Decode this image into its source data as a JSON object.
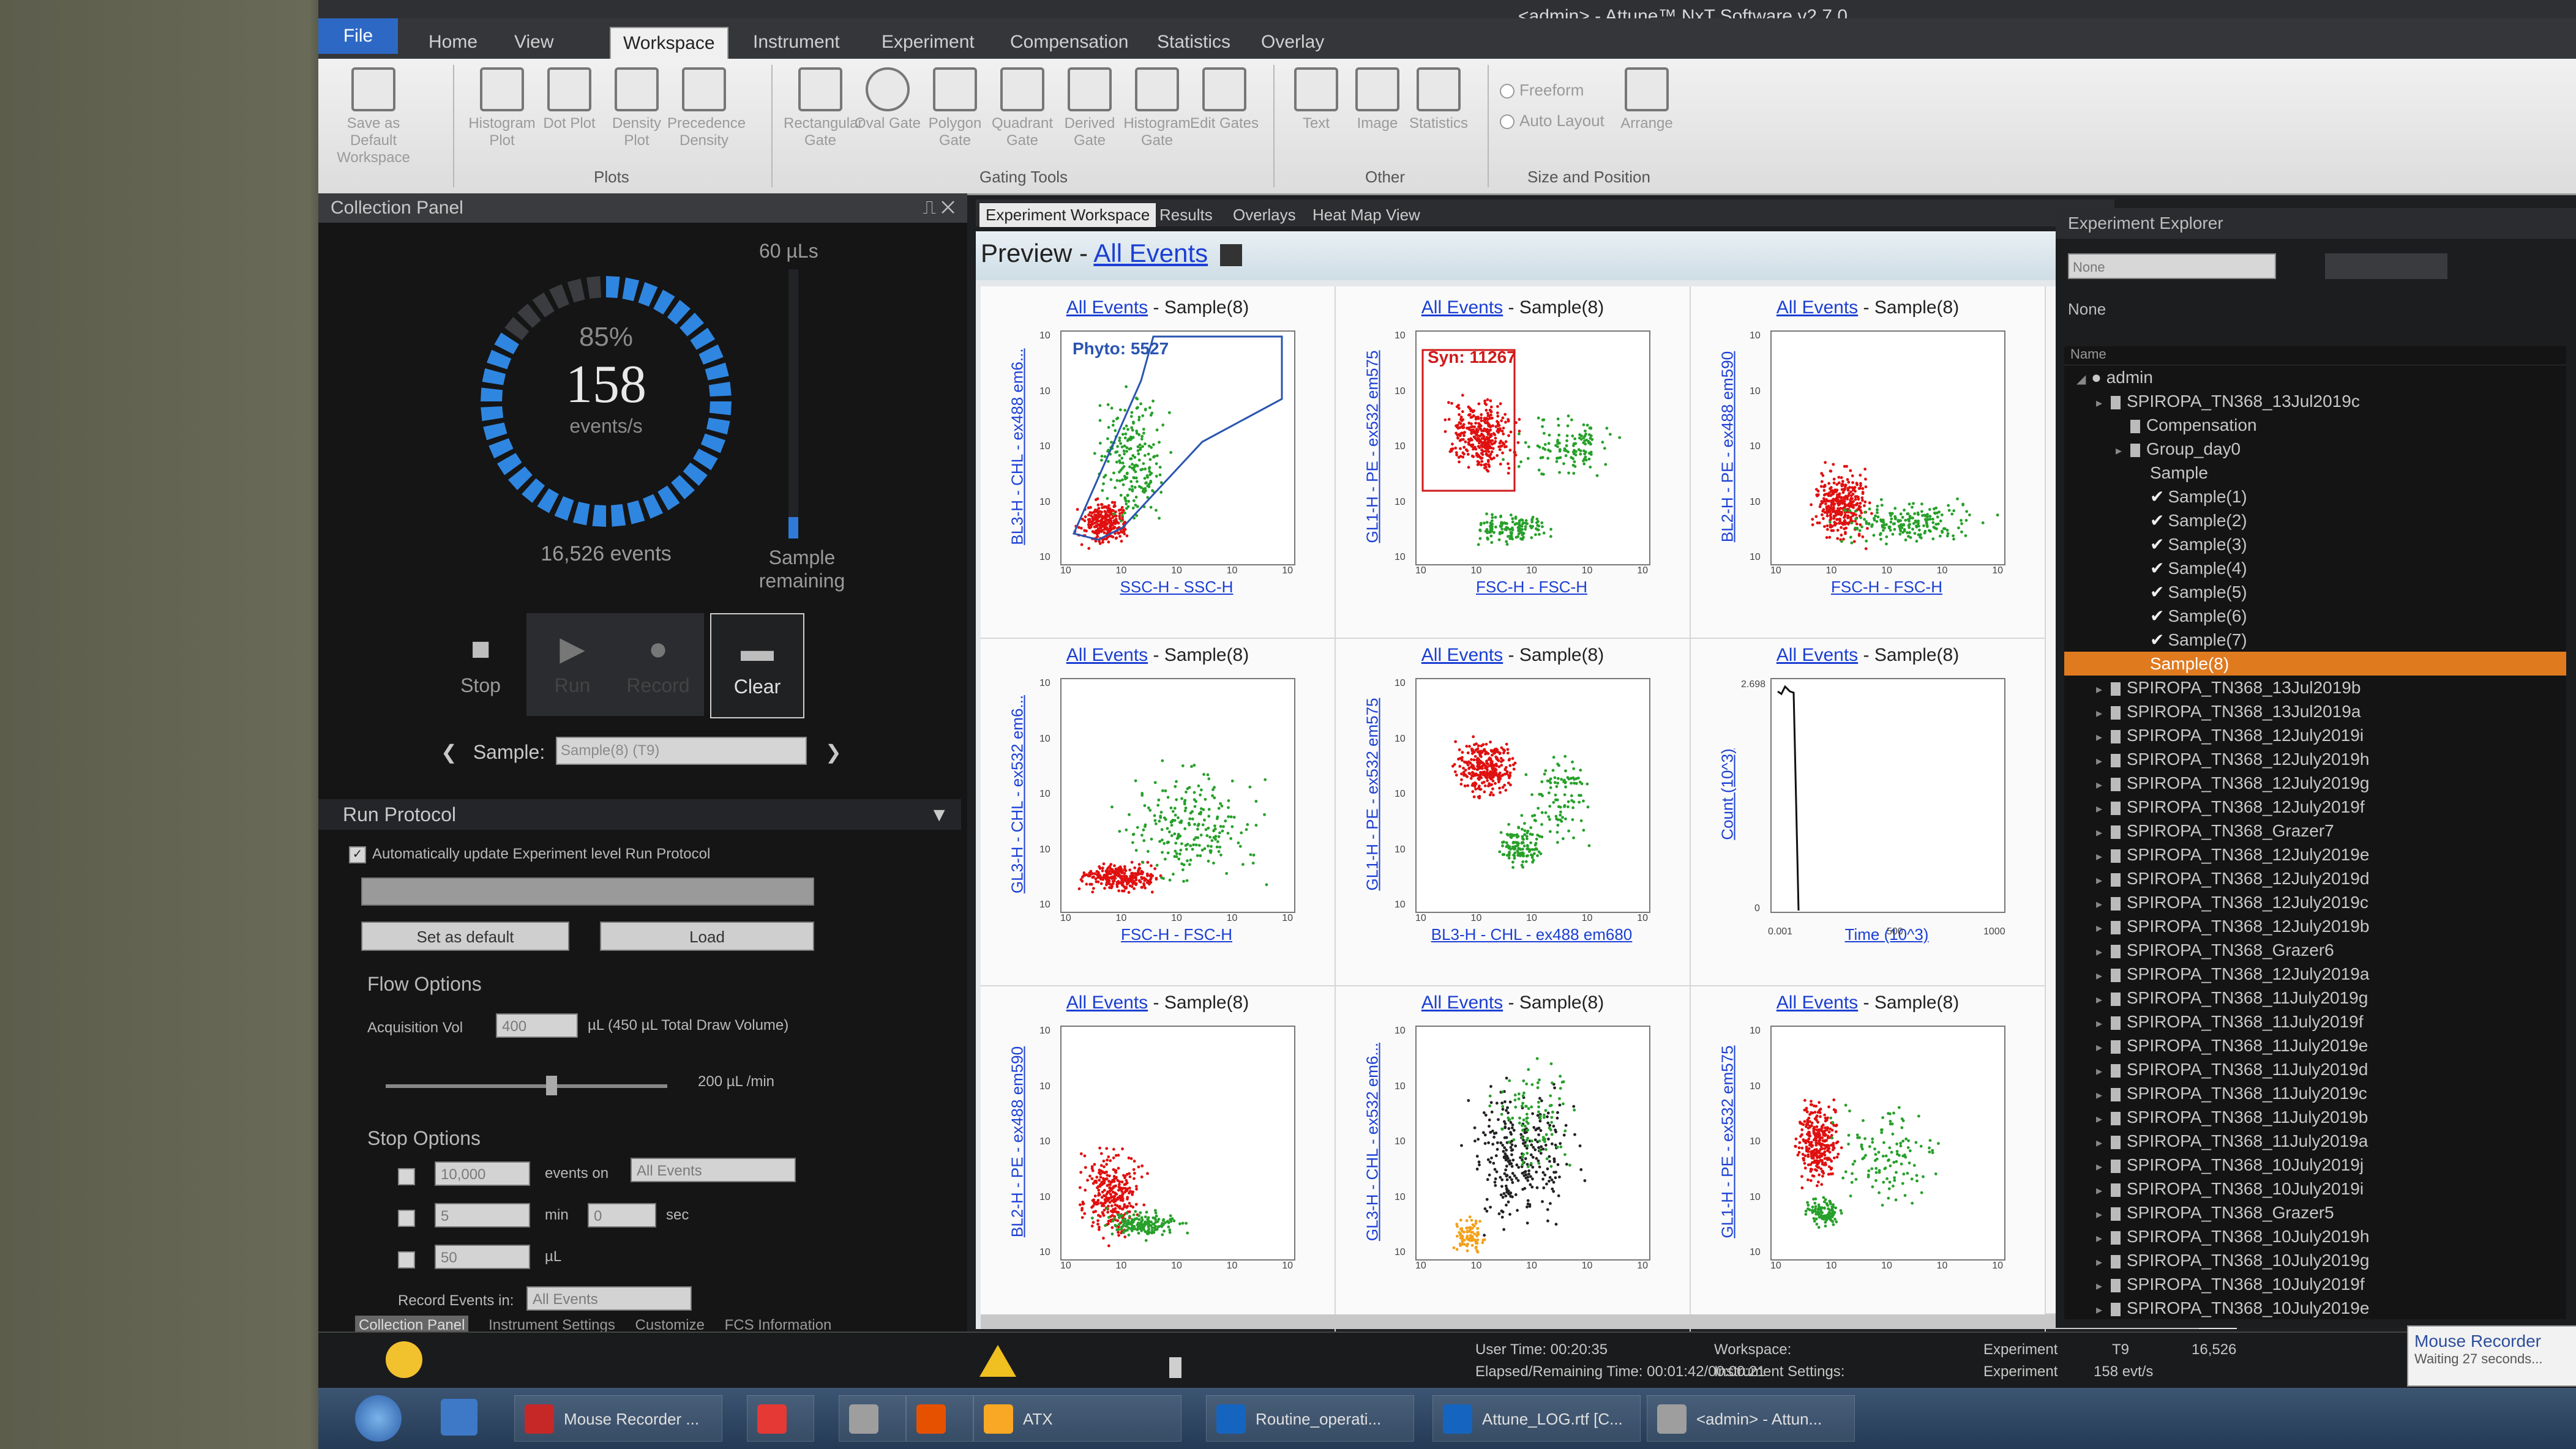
{
  "app": {
    "title": "<admin> - Attune™ NxT Software v2.7.0"
  },
  "menu_tabs": [
    "File",
    "Home",
    "View",
    "Workspace",
    "Instrument",
    "Experiment",
    "Compensation",
    "Statistics",
    "Overlay"
  ],
  "ribbon": {
    "buttons": [
      {
        "label": "Save as Default Workspace"
      },
      {
        "label": "Histogram Plot"
      },
      {
        "label": "Dot Plot"
      },
      {
        "label": "Density Plot"
      },
      {
        "label": "Precedence Density"
      },
      {
        "label": "Rectangular Gate"
      },
      {
        "label": "Oval Gate"
      },
      {
        "label": "Polygon Gate"
      },
      {
        "label": "Quadrant Gate"
      },
      {
        "label": "Derived Gate"
      },
      {
        "label": "Histogram Gate"
      },
      {
        "label": "Edit Gates"
      },
      {
        "label": "Text"
      },
      {
        "label": "Image"
      },
      {
        "label": "Statistics"
      }
    ],
    "groups": {
      "plots": "Plots",
      "gating": "Gating Tools",
      "other": "Other",
      "size": "Size and Position"
    },
    "freeform": "Freeform",
    "auto_layout": "Auto Layout",
    "arrange": "Arrange"
  },
  "collection_panel": {
    "title": "Collection Panel",
    "gauge_pct": "85%",
    "rate": "158",
    "rate_unit": "events/s",
    "events": "16,526 events",
    "volume": "60 µLs",
    "volume_fraction": 0.08,
    "remaining": "Sample remaining",
    "stop": "Stop",
    "run": "Run",
    "record": "Record",
    "clear": "Clear",
    "sample_label": "Sample:",
    "sample_value": "Sample(8) (T9)",
    "run_protocol": "Run Protocol",
    "auto_update": "Automatically update Experiment level Run Protocol",
    "set_default": "Set as default",
    "load": "Load",
    "flow_options": "Flow Options",
    "acq_label": "Acquisition Vol",
    "acq_value": "400",
    "acq_note": "µL (450 µL Total Draw Volume)",
    "flow_rate": "200 µL /min",
    "stop_options": "Stop Options",
    "stop_events": "10,000",
    "events_on": "events on",
    "events_gate": "All Events",
    "stop_min": "5",
    "min": "min",
    "stop_sec": "0",
    "sec": "sec",
    "stop_ul": "50",
    "ul": "µL",
    "record_in": "Record Events in:",
    "record_gate": "All Events",
    "bottom_tabs": [
      "Collection Panel",
      "Instrument Settings",
      "Customize",
      "FCS Information"
    ]
  },
  "workspace_tabs": [
    "Experiment Workspace",
    "Results",
    "Overlays",
    "Heat Map View"
  ],
  "preview": {
    "prefix": "Preview - ",
    "link": "All Events"
  },
  "plots": [
    {
      "link": "All Events",
      "suffix": " - Sample(8)",
      "ylabel": "BL3-H - CHL - ex488 em6...",
      "xlabel": "SSC-H - SSC-H",
      "gate": "Phyto: 5527",
      "gate_color": "#2a55b0"
    },
    {
      "link": "All Events",
      "suffix": " - Sample(8)",
      "ylabel": "GL1-H - PE - ex532 em575",
      "xlabel": "FSC-H - FSC-H",
      "gate": "Syn: 11267",
      "gate_color": "#d01a1a"
    },
    {
      "link": "All Events",
      "suffix": " - Sample(8)",
      "ylabel": "BL2-H - PE - ex488 em590",
      "xlabel": "FSC-H - FSC-H",
      "gate": "",
      "gate_color": ""
    },
    {
      "link": "All Events",
      "suffix": " - Sample(8)",
      "ylabel": "GL3-H - CHL - ex532 em6...",
      "xlabel": "FSC-H - FSC-H",
      "gate": "",
      "gate_color": ""
    },
    {
      "link": "All Events",
      "suffix": " - Sample(8)",
      "ylabel": "GL1-H - PE - ex532 em575",
      "xlabel": "BL3-H - CHL - ex488 em680",
      "gate": "",
      "gate_color": ""
    },
    {
      "link": "All Events",
      "suffix": " - Sample(8)",
      "ylabel": "Count (10^3)",
      "xlabel": "Time (10^3)",
      "gate": "",
      "gate_color": ""
    },
    {
      "link": "All Events",
      "suffix": " - Sample(8)",
      "ylabel": "BL2-H - PE - ex488 em590",
      "xlabel": "",
      "gate": "",
      "gate_color": ""
    },
    {
      "link": "All Events",
      "suffix": " - Sample(8)",
      "ylabel": "GL3-H - CHL - ex532 em6...",
      "xlabel": "",
      "gate": "",
      "gate_color": ""
    },
    {
      "link": "All Events",
      "suffix": " - Sample(8)",
      "ylabel": "GL1-H - PE - ex532 em575",
      "xlabel": "",
      "gate": "",
      "gate_color": ""
    }
  ],
  "histogram_ticks": {
    "x": [
      "0.001",
      "500",
      "1000"
    ],
    "y": [
      "2.698",
      "0"
    ]
  },
  "explorer": {
    "title": "Experiment Explorer",
    "select": "None",
    "none": "None",
    "name_col": "Name",
    "tree": [
      {
        "t": "admin",
        "lvl": 0,
        "kind": "user"
      },
      {
        "t": "SPIROPA_TN368_13Jul2019c",
        "lvl": 1,
        "kind": "file"
      },
      {
        "t": "Compensation",
        "lvl": 2,
        "kind": "comp"
      },
      {
        "t": "Group_day0",
        "lvl": 2,
        "kind": "file"
      },
      {
        "t": "Sample",
        "lvl": 3,
        "kind": "plain"
      },
      {
        "t": "Sample(1)",
        "lvl": 3,
        "kind": "check"
      },
      {
        "t": "Sample(2)",
        "lvl": 3,
        "kind": "check"
      },
      {
        "t": "Sample(3)",
        "lvl": 3,
        "kind": "check"
      },
      {
        "t": "Sample(4)",
        "lvl": 3,
        "kind": "check"
      },
      {
        "t": "Sample(5)",
        "lvl": 3,
        "kind": "check"
      },
      {
        "t": "Sample(6)",
        "lvl": 3,
        "kind": "check"
      },
      {
        "t": "Sample(7)",
        "lvl": 3,
        "kind": "check"
      },
      {
        "t": "Sample(8)",
        "lvl": 3,
        "kind": "selected"
      },
      {
        "t": "SPIROPA_TN368_13Jul2019b",
        "lvl": 1,
        "kind": "file"
      },
      {
        "t": "SPIROPA_TN368_13Jul2019a",
        "lvl": 1,
        "kind": "file"
      },
      {
        "t": "SPIROPA_TN368_12July2019i",
        "lvl": 1,
        "kind": "file"
      },
      {
        "t": "SPIROPA_TN368_12July2019h",
        "lvl": 1,
        "kind": "file"
      },
      {
        "t": "SPIROPA_TN368_12July2019g",
        "lvl": 1,
        "kind": "file"
      },
      {
        "t": "SPIROPA_TN368_12July2019f",
        "lvl": 1,
        "kind": "file"
      },
      {
        "t": "SPIROPA_TN368_Grazer7",
        "lvl": 1,
        "kind": "file"
      },
      {
        "t": "SPIROPA_TN368_12July2019e",
        "lvl": 1,
        "kind": "file"
      },
      {
        "t": "SPIROPA_TN368_12July2019d",
        "lvl": 1,
        "kind": "file"
      },
      {
        "t": "SPIROPA_TN368_12July2019c",
        "lvl": 1,
        "kind": "file"
      },
      {
        "t": "SPIROPA_TN368_12July2019b",
        "lvl": 1,
        "kind": "file"
      },
      {
        "t": "SPIROPA_TN368_Grazer6",
        "lvl": 1,
        "kind": "file"
      },
      {
        "t": "SPIROPA_TN368_12July2019a",
        "lvl": 1,
        "kind": "file"
      },
      {
        "t": "SPIROPA_TN368_11July2019g",
        "lvl": 1,
        "kind": "file"
      },
      {
        "t": "SPIROPA_TN368_11July2019f",
        "lvl": 1,
        "kind": "file"
      },
      {
        "t": "SPIROPA_TN368_11July2019e",
        "lvl": 1,
        "kind": "file"
      },
      {
        "t": "SPIROPA_TN368_11July2019d",
        "lvl": 1,
        "kind": "file"
      },
      {
        "t": "SPIROPA_TN368_11July2019c",
        "lvl": 1,
        "kind": "file"
      },
      {
        "t": "SPIROPA_TN368_11July2019b",
        "lvl": 1,
        "kind": "file"
      },
      {
        "t": "SPIROPA_TN368_11July2019a",
        "lvl": 1,
        "kind": "file"
      },
      {
        "t": "SPIROPA_TN368_10July2019j",
        "lvl": 1,
        "kind": "file"
      },
      {
        "t": "SPIROPA_TN368_10July2019i",
        "lvl": 1,
        "kind": "file"
      },
      {
        "t": "SPIROPA_TN368_Grazer5",
        "lvl": 1,
        "kind": "file"
      },
      {
        "t": "SPIROPA_TN368_10July2019h",
        "lvl": 1,
        "kind": "file"
      },
      {
        "t": "SPIROPA_TN368_10July2019g",
        "lvl": 1,
        "kind": "file"
      },
      {
        "t": "SPIROPA_TN368_10July2019f",
        "lvl": 1,
        "kind": "file"
      },
      {
        "t": "SPIROPA_TN368_10July2019e",
        "lvl": 1,
        "kind": "file"
      }
    ]
  },
  "status": {
    "user_time": "User Time: 00:20:35",
    "elapsed": "Elapsed/Remaining Time: 00:01:42/00:00:21",
    "workspace_label": "Workspace:",
    "workspace_val": "Experiment",
    "instr_label": "Instrument Settings:",
    "instr_val": "Experiment",
    "tube": "T9",
    "rate": "158 evt/s",
    "count": "16,526"
  },
  "recorder": {
    "title": "Mouse Recorder",
    "sub": "Waiting 27 seconds..."
  },
  "taskbar": [
    {
      "label": "Mouse Recorder ...",
      "color": "#c62828"
    },
    {
      "label": "",
      "color": "#e53935"
    },
    {
      "label": "",
      "color": "#9e9e9e"
    },
    {
      "label": "",
      "color": "#e65100"
    },
    {
      "label": "ATX",
      "color": "#f9a825"
    },
    {
      "label": "Routine_operati...",
      "color": "#1565c0"
    },
    {
      "label": "Attune_LOG.rtf [C...",
      "color": "#1565c0"
    },
    {
      "label": "<admin> - Attun...",
      "color": "#9e9e9e"
    }
  ]
}
